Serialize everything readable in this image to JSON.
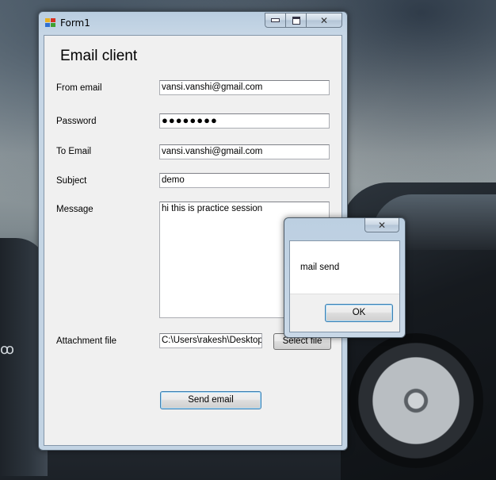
{
  "window": {
    "title": "Form1",
    "controls": {
      "close_symbol": "✕"
    }
  },
  "form": {
    "heading": "Email client",
    "labels": {
      "from_email": "From email",
      "password": "Password",
      "to_email": "To Email",
      "subject": "Subject",
      "message": "Message",
      "attachment": "Attachment file"
    },
    "values": {
      "from_email": "vansi.vanshi@gmail.com",
      "password": "●●●●●●●●",
      "to_email": "vansi.vanshi@gmail.com",
      "subject": "demo",
      "message": "hi this is practice session",
      "attachment": "C:\\Users\\rakesh\\Desktop"
    },
    "buttons": {
      "select_file": "Select file",
      "send_email": "Send email"
    }
  },
  "message_box": {
    "text": "mail send",
    "ok_label": "OK",
    "close_symbol": "✕"
  },
  "icons": {
    "app": "winforms-app-icon",
    "minimize": "minimize-icon",
    "maximize": "maximize-icon",
    "close": "close-icon"
  }
}
